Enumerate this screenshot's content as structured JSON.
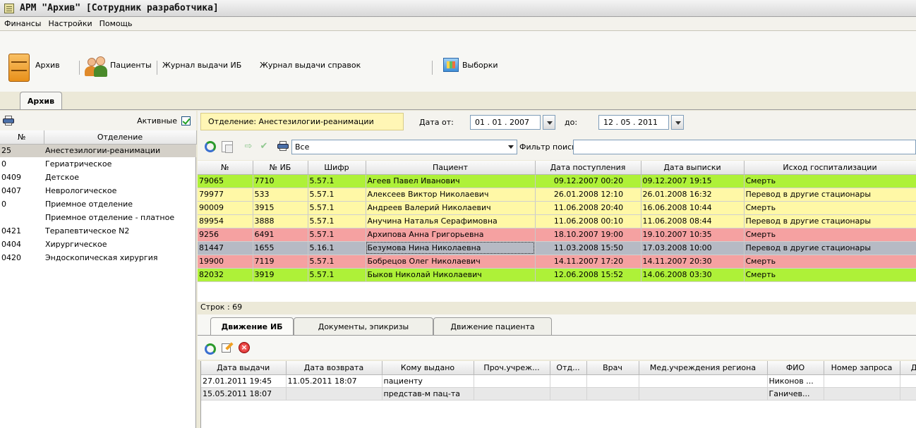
{
  "window": {
    "title": "АРМ \"Архив\" [Сотрудник разработчика]"
  },
  "menu": [
    "Финансы",
    "Настройки",
    "Помощь"
  ],
  "toolbar": {
    "archive": "Архив",
    "patients": "Пациенты",
    "journal_ib": "Журнал выдачи ИБ",
    "journal_spravok": "Журнал выдачи справок",
    "selections": "Выборки"
  },
  "main_tab": "Архив",
  "left": {
    "active_label": "Активные",
    "active_checked": true,
    "columns": [
      "№",
      "Отделение"
    ],
    "rows": [
      {
        "code": "25",
        "name": "Анестезилогии-реанимации",
        "selected": true
      },
      {
        "code": "0",
        "name": "Гериатрическое"
      },
      {
        "code": "0409",
        "name": "Детское"
      },
      {
        "code": "0407",
        "name": "Неврологическое"
      },
      {
        "code": "0",
        "name": "Приемное отделение"
      },
      {
        "code": "",
        "name": "Приемное отделение - платное"
      },
      {
        "code": "0421",
        "name": "Терапевтическое N2"
      },
      {
        "code": "0404",
        "name": "Хирургическое"
      },
      {
        "code": "0420",
        "name": "Эндоскопическая хирургия"
      }
    ]
  },
  "filter": {
    "department": "Отделение: Анестезилогии-реанимации",
    "date_from_label": "Дата от:",
    "date_from": "01 . 01 . 2007",
    "date_to_label": "до:",
    "date_to": "12 . 05 . 2011",
    "combo_value": "Все",
    "search_label": "Фильтр поиска",
    "search_value": ""
  },
  "grid": {
    "columns": [
      "№",
      "№ ИБ",
      "Шифр",
      "Пациент",
      "Дата поступления",
      "Дата выписки",
      "Исход госпитализации"
    ],
    "rows": [
      {
        "color": "green",
        "cells": [
          "79065",
          "7710",
          "5.57.1",
          "Агеев Павел Иванович",
          "09.12.2007 00:20",
          "09.12.2007 19:15",
          "Смерть"
        ]
      },
      {
        "color": "yellow",
        "cells": [
          "79977",
          "533",
          "5.57.1",
          "Алексеев Виктор Николаевич",
          "26.01.2008 12:10",
          "26.01.2008 16:32",
          "Перевод в другие стационары"
        ]
      },
      {
        "color": "yellow",
        "cells": [
          "90009",
          "3915",
          "5.57.1",
          "Андреев Валерий Николаевич",
          "11.06.2008 20:40",
          "16.06.2008 10:44",
          "Смерть"
        ]
      },
      {
        "color": "yellow",
        "cells": [
          "89954",
          "3888",
          "5.57.1",
          "Анучина Наталья Серафимовна",
          "11.06.2008 00:10",
          "11.06.2008 08:44",
          "Перевод в другие стационары"
        ]
      },
      {
        "color": "red",
        "cells": [
          "9256",
          "6491",
          "5.57.1",
          "Архипова Анна Григорьевна",
          "18.10.2007 19:00",
          "19.10.2007 10:35",
          "Смерть"
        ]
      },
      {
        "color": "gray",
        "cells": [
          "81447",
          "1655",
          "5.16.1",
          "Безумова Нина Николаевна",
          "11.03.2008 15:50",
          "17.03.2008 10:00",
          "Перевод в другие стационары"
        ]
      },
      {
        "color": "red",
        "cells": [
          "19900",
          "7119",
          "5.57.1",
          "Бобрецов Олег Николаевич",
          "14.11.2007 17:20",
          "14.11.2007 20:30",
          "Смерть"
        ]
      },
      {
        "color": "green",
        "cells": [
          "82032",
          "3919",
          "5.57.1",
          "Быков Николай Николаевич",
          "12.06.2008 15:52",
          "14.06.2008 03:30",
          "Смерть"
        ]
      }
    ],
    "row_count": "Строк : 69"
  },
  "bottom_tabs": [
    "Движение ИБ",
    "Документы, эпикризы",
    "Движение пациента"
  ],
  "movement": {
    "columns": [
      "Дата выдачи",
      "Дата возврата",
      "Кому выдано",
      "Проч.учреж...",
      "Отд...",
      "Врач",
      "Мед.учреждения региона",
      "ФИО",
      "Номер запроса",
      "Д"
    ],
    "rows": [
      [
        "27.01.2011 19:45",
        "11.05.2011 18:07",
        "пациенту",
        "",
        "",
        "",
        "",
        "Никонов ...",
        "",
        ""
      ],
      [
        "15.05.2011 18:07",
        "",
        "представ-м пац-та",
        "",
        "",
        "",
        "",
        "Ганичев...",
        "",
        ""
      ]
    ]
  },
  "colors": {
    "green": "#aef138",
    "yellow": "#fff8a6",
    "red": "#f5a1a1",
    "gray": "#b6bac4",
    "dept_label_bg": "#fff6b5"
  }
}
